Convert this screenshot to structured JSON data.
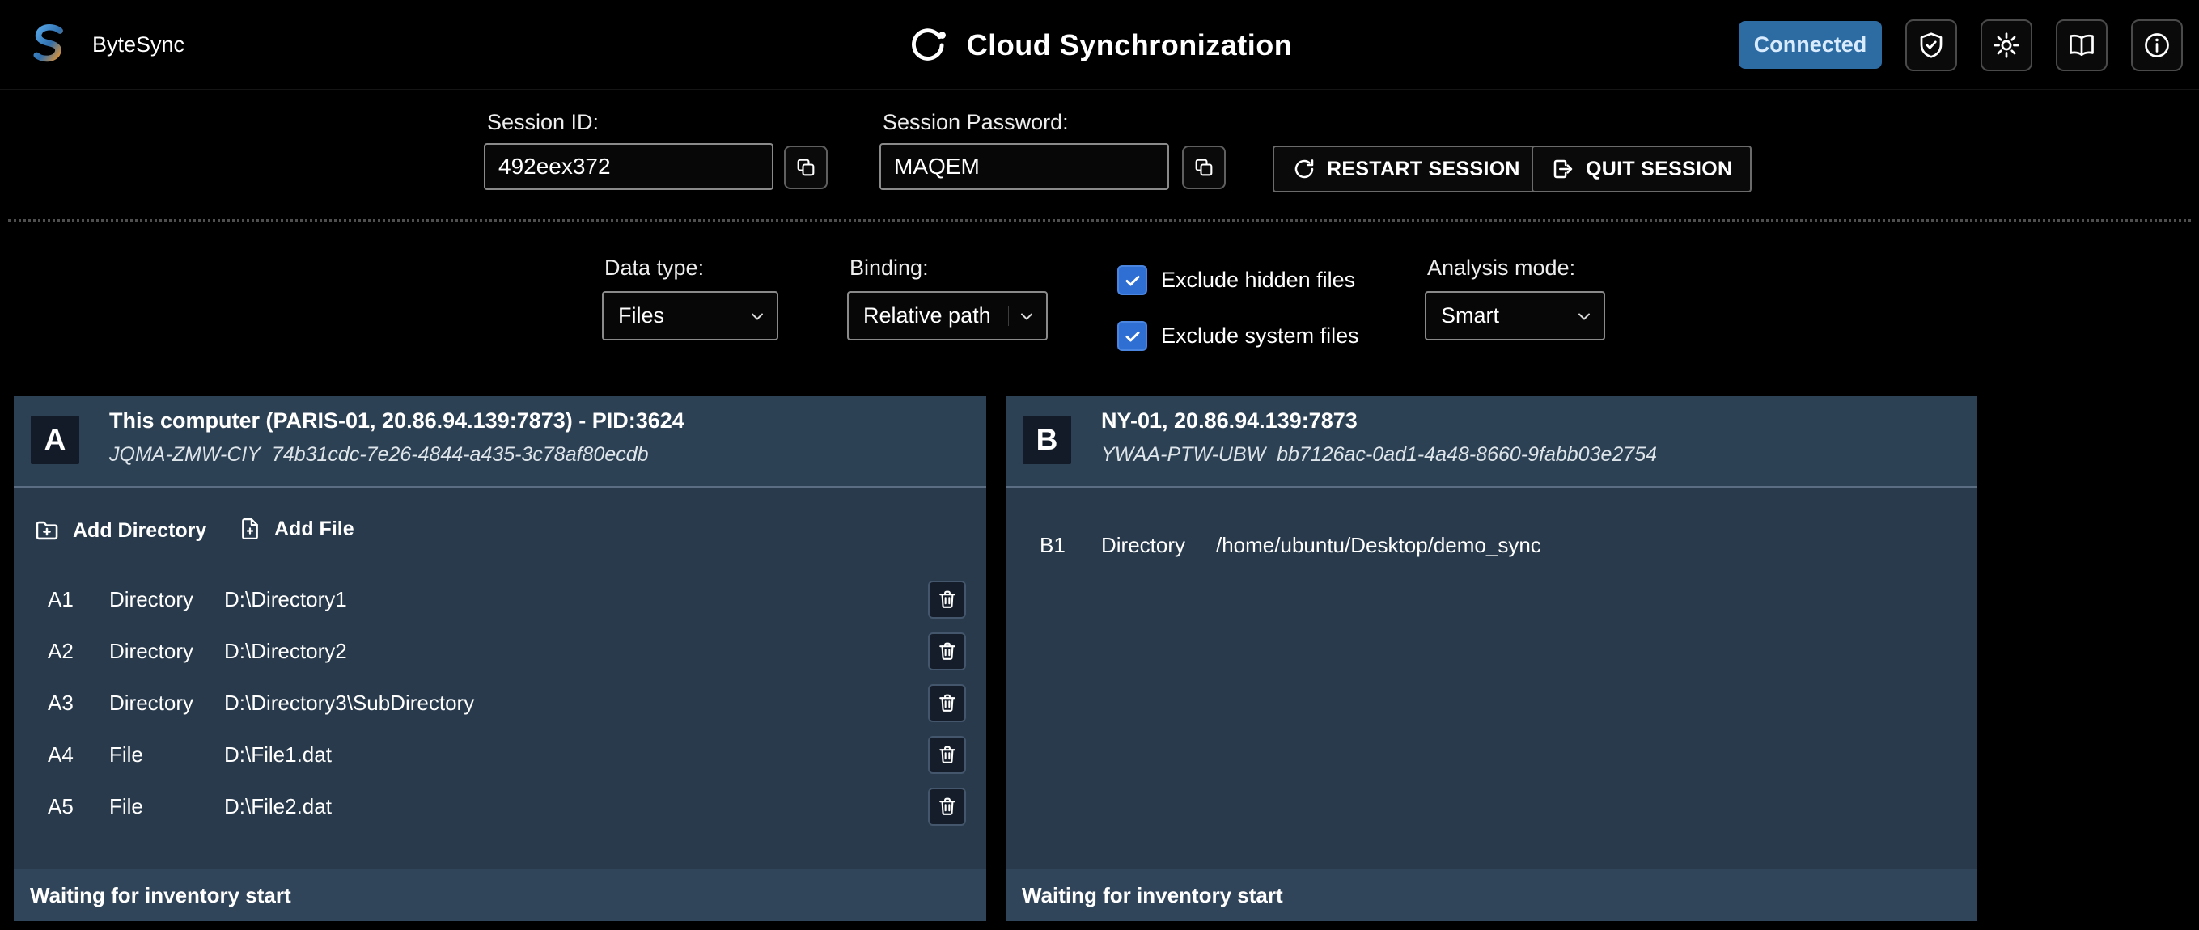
{
  "topbar": {
    "brand": "ByteSync",
    "title": "Cloud Synchronization",
    "status": "Connected"
  },
  "session": {
    "id_label": "Session ID:",
    "id_value": "492eex372",
    "password_label": "Session Password:",
    "password_value": "MAQEM",
    "restart_label": "RESTART SESSION",
    "quit_label": "QUIT SESSION"
  },
  "options": {
    "data_type_label": "Data type:",
    "data_type_value": "Files",
    "binding_label": "Binding:",
    "binding_value": "Relative path",
    "exclude_hidden_label": "Exclude hidden files",
    "exclude_hidden_checked": true,
    "exclude_system_label": "Exclude system files",
    "exclude_system_checked": true,
    "analysis_label": "Analysis mode:",
    "analysis_value": "Smart"
  },
  "panels": [
    {
      "letter": "A",
      "title": "This computer (PARIS-01, 20.86.94.139:7873) - PID:3624",
      "client_id": "JQMA-ZMW-CIY_74b31cdc-7e26-4844-a435-3c78af80ecdb",
      "add_directory_label": "Add Directory",
      "add_file_label": "Add File",
      "items": [
        {
          "id": "A1",
          "type": "Directory",
          "path": "D:\\Directory1"
        },
        {
          "id": "A2",
          "type": "Directory",
          "path": "D:\\Directory2"
        },
        {
          "id": "A3",
          "type": "Directory",
          "path": "D:\\Directory3\\SubDirectory"
        },
        {
          "id": "A4",
          "type": "File",
          "path": "D:\\File1.dat"
        },
        {
          "id": "A5",
          "type": "File",
          "path": "D:\\File2.dat"
        }
      ],
      "status": "Waiting for inventory start"
    },
    {
      "letter": "B",
      "title": "NY-01, 20.86.94.139:7873",
      "client_id": "YWAA-PTW-UBW_bb7126ac-0ad1-4a48-8660-9fabb03e2754",
      "items": [
        {
          "id": "B1",
          "type": "Directory",
          "path": "/home/ubuntu/Desktop/demo_sync"
        }
      ],
      "status": "Waiting for inventory start"
    }
  ],
  "colors": {
    "status_blue": "#2d6ba3",
    "checkbox_blue": "#2f6fd4",
    "panel_bg": "#283a4c",
    "panel_band": "#2d4154"
  }
}
